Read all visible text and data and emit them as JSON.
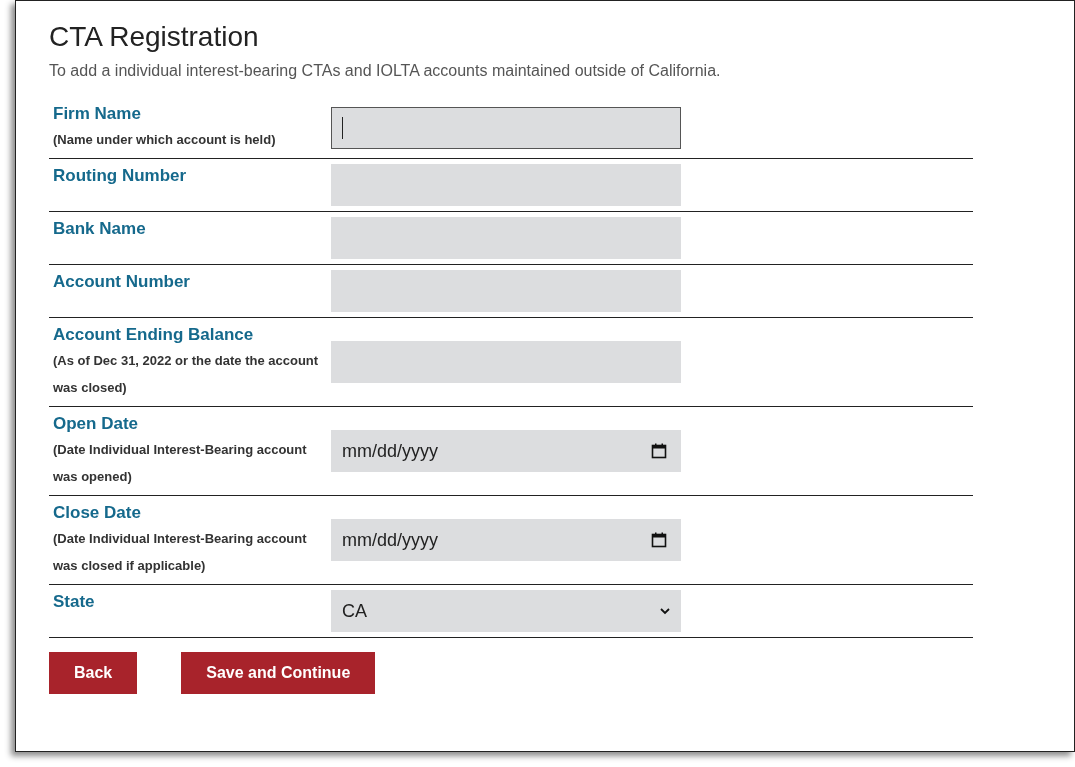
{
  "title": "CTA Registration",
  "subtitle": "To add a individual interest-bearing CTAs and IOLTA accounts maintained outside of California.",
  "fields": [
    {
      "kind": "text",
      "label": "Firm Name",
      "hint": "(Name under which account is held)",
      "focused": true
    },
    {
      "kind": "text",
      "label": "Routing Number",
      "focused": false
    },
    {
      "kind": "text",
      "label": "Bank Name",
      "focused": false
    },
    {
      "kind": "text",
      "label": "Account Number",
      "focused": false
    },
    {
      "kind": "text",
      "label": "Account Ending Balance",
      "hint": "(As of Dec 31, 2022 or the date the account was closed)",
      "focused": false
    },
    {
      "kind": "date",
      "label": "Open Date",
      "hint": "(Date Individual Interest-Bearing account was opened)",
      "placeholder": "mm/dd/yyyy",
      "focused": false
    },
    {
      "kind": "date",
      "label": "Close Date",
      "hint": "(Date Individual Interest-Bearing account was closed if applicable)",
      "placeholder": "mm/dd/yyyy",
      "focused": false
    },
    {
      "kind": "select",
      "label": "State",
      "value": "CA",
      "focused": false
    }
  ],
  "buttons": [
    "Back",
    "Save and Continue"
  ]
}
